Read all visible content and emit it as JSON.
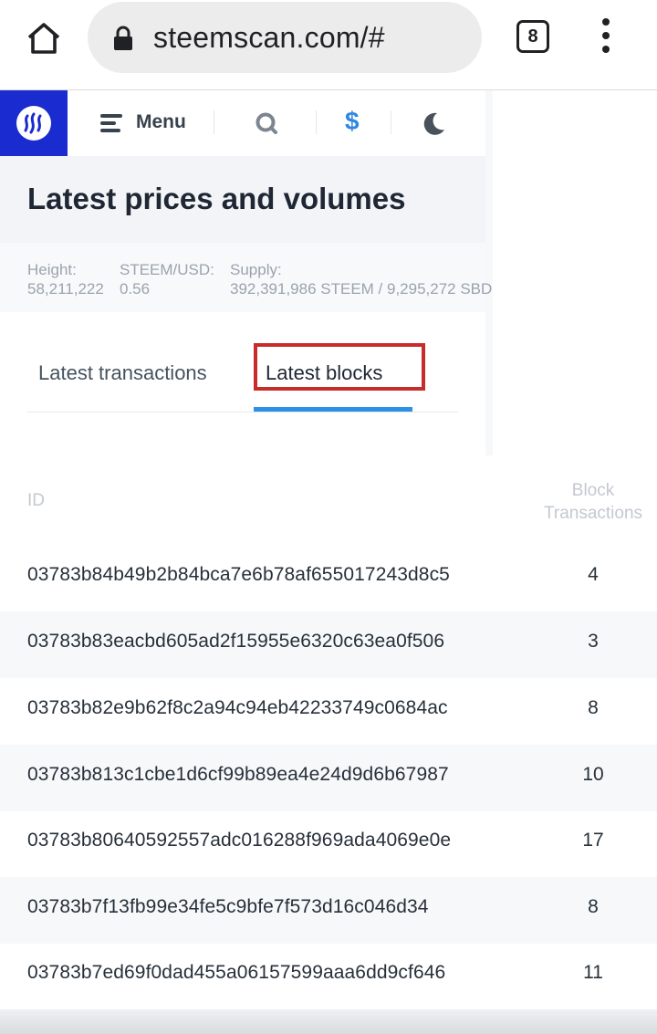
{
  "browser": {
    "url": "steemscan.com/#",
    "tab_count": "8",
    "icons": [
      "home-icon",
      "lock-icon",
      "more-vert-icon"
    ]
  },
  "nav": {
    "menu_label": "Menu",
    "icons": [
      "steem-logo-icon",
      "menu-icon",
      "search-icon",
      "dollar-icon",
      "moon-icon"
    ],
    "dollar_glyph": "$"
  },
  "hero": {
    "title": "Latest prices and volumes"
  },
  "stats": {
    "height_label": "Height:",
    "height_value": "58,211,222",
    "price_label": "STEEM/USD:",
    "price_value": "0.56",
    "supply_label": "Supply:",
    "supply_value": "392,391,986 STEEM / 9,295,272 SBD"
  },
  "tabs": {
    "transactions": "Latest transactions",
    "blocks": "Latest blocks",
    "active": "blocks"
  },
  "table": {
    "headers": {
      "id": "ID",
      "tx_line1": "Block",
      "tx_line2": "Transactions"
    },
    "rows": [
      {
        "id": "03783b84b49b2b84bca7e6b78af655017243d8c5",
        "tx": "4"
      },
      {
        "id": "03783b83eacbd605ad2f15955e6320c63ea0f506",
        "tx": "3"
      },
      {
        "id": "03783b82e9b62f8c2a94c94eb42233749c0684ac",
        "tx": "8"
      },
      {
        "id": "03783b813c1cbe1d6cf99b89ea4e24d9d6b67987",
        "tx": "10"
      },
      {
        "id": "03783b80640592557adc016288f969ada4069e0e",
        "tx": "17"
      },
      {
        "id": "03783b7f13fb99e34fe5c9bfe7f573d16c046d34",
        "tx": "8"
      },
      {
        "id": "03783b7ed69f0dad455a06157599aaa6dd9cf646",
        "tx": "11"
      }
    ]
  },
  "colors": {
    "brand": "#1a2ccf",
    "tab_active_underline": "#2d8fe6",
    "highlight_box": "#c92a2a",
    "dollar": "#2f87e0"
  }
}
